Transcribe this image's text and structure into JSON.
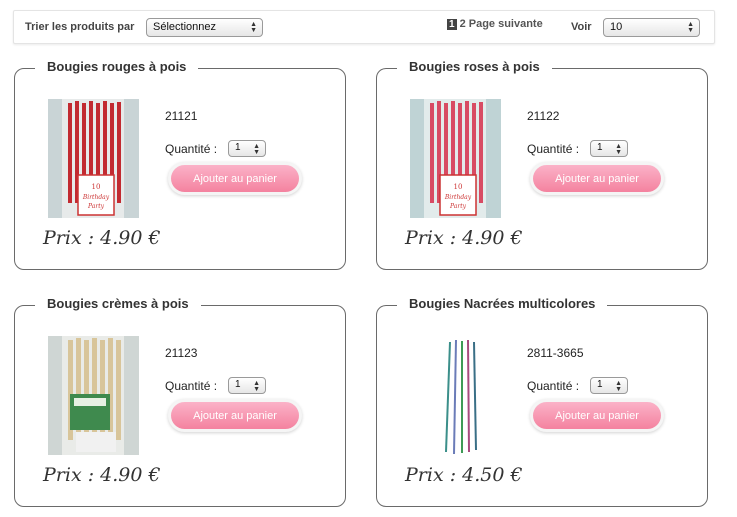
{
  "toolbar": {
    "sort_label": "Trier les produits par",
    "sort_value": "Sélectionnez",
    "pager_current": "1",
    "pager_next": "2 Page suivante",
    "voir_label": "Voir",
    "voir_value": "10"
  },
  "products": [
    {
      "title": "Bougies rouges à pois",
      "ref": "21121",
      "qty_label": "Quantité :",
      "qty": "1",
      "button": "Ajouter au panier",
      "price": "Prix : 4.90 €",
      "candle_color": "#c22a31"
    },
    {
      "title": "Bougies roses à pois",
      "ref": "21122",
      "qty_label": "Quantité :",
      "qty": "1",
      "button": "Ajouter au panier",
      "price": "Prix : 4.90 €",
      "candle_color": "#d84b63"
    },
    {
      "title": "Bougies crèmes à pois",
      "ref": "21123",
      "qty_label": "Quantité :",
      "qty": "1",
      "button": "Ajouter au panier",
      "price": "Prix : 4.90 €",
      "candle_color": "#d8c59a"
    },
    {
      "title": "Bougies Nacrées multicolores",
      "ref": "2811-3665",
      "qty_label": "Quantité :",
      "qty": "1",
      "button": "Ajouter au panier",
      "price": "Prix : 4.50 €",
      "candle_color": "#3f8f86"
    }
  ]
}
